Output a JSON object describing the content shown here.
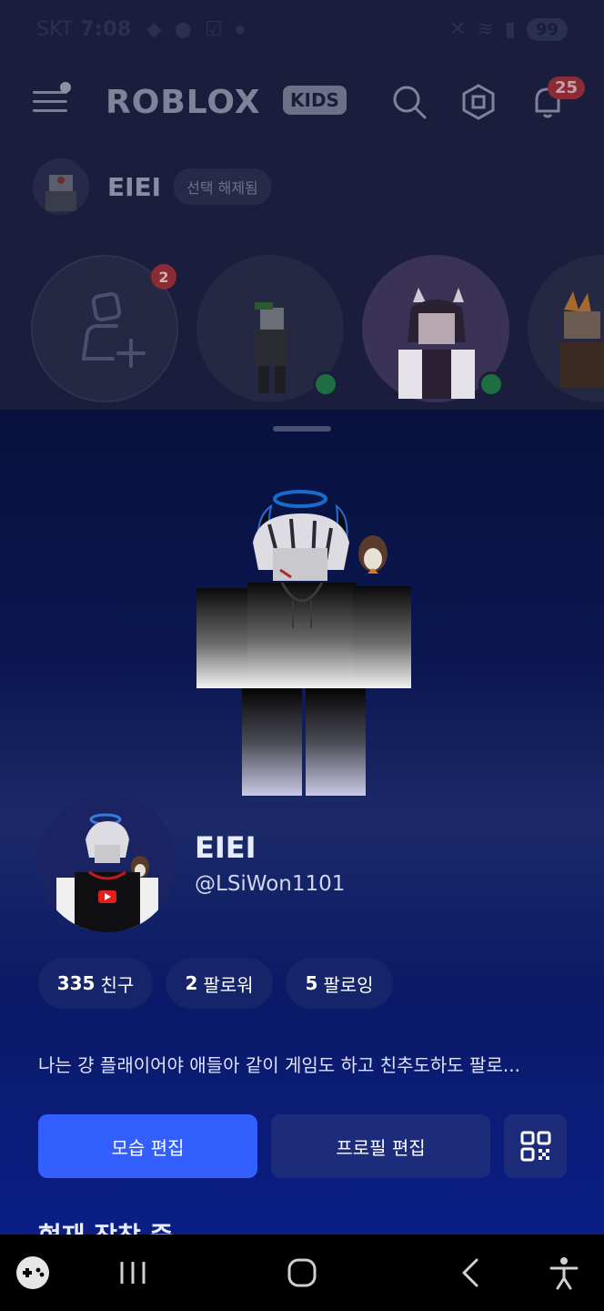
{
  "status_bar": {
    "carrier": "SKT",
    "time": "7:08",
    "battery": "99"
  },
  "header": {
    "logo_text": "ROBLOX",
    "kids_badge": "KIDS",
    "notification_count": "25"
  },
  "background_profile": {
    "name": "EIEI",
    "status": "선택 해제됨",
    "friend_request_count": "2"
  },
  "profile": {
    "display_name": "EIEI",
    "username": "@LSiWon1101",
    "stats": [
      {
        "count": "335",
        "label": "친구"
      },
      {
        "count": "2",
        "label": "팔로워"
      },
      {
        "count": "5",
        "label": "팔로잉"
      }
    ],
    "bio": "나는 걍 플래이어야 애들아 같이 게임도 하고 친추도하도 팔로...",
    "buttons": {
      "edit_avatar": "모습 편집",
      "edit_profile": "프로필 편집"
    },
    "section_title": "현재 장착 중"
  },
  "colors": {
    "primary_button": "#335fff",
    "secondary_button": "#1c2c7a",
    "notification_badge": "#8a2c36",
    "online": "#1f6e43"
  }
}
